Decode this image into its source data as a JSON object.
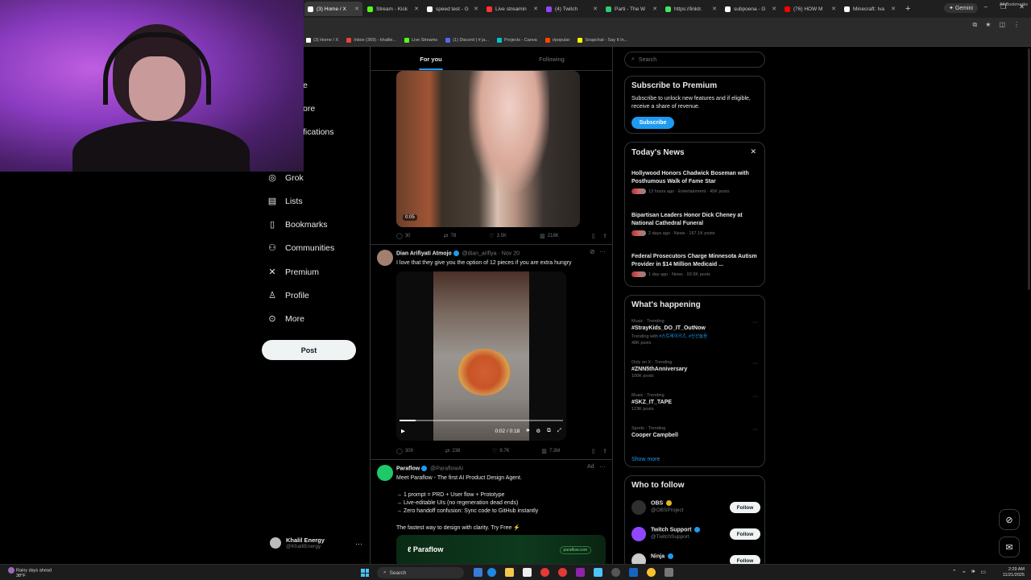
{
  "browser": {
    "tabs": [
      {
        "label": "(3) Home / X",
        "color": "#ffffff",
        "active": true
      },
      {
        "label": "Stream - Kick",
        "color": "#53fc18"
      },
      {
        "label": "speed test - G",
        "color": "#ffffff"
      },
      {
        "label": "Live streamin",
        "color": "#ff3333"
      },
      {
        "label": "(4) Twitch",
        "color": "#9146ff"
      },
      {
        "label": "Parti - The W",
        "color": "#2ecc71"
      },
      {
        "label": "https://linktr.",
        "color": "#43e660"
      },
      {
        "label": "subpoena - G",
        "color": "#ffffff"
      },
      {
        "label": "(76) HOW M",
        "color": "#ff0000"
      },
      {
        "label": "Minecraft: Iva",
        "color": "#ffffff"
      }
    ],
    "gemini_label": "Gemini",
    "bookmarks": [
      {
        "label": "(3) Home / X",
        "color": "#ffffff"
      },
      {
        "label": "Inbox (369) - khalile...",
        "color": "#ea4335"
      },
      {
        "label": "Live Streams",
        "color": "#53fc18"
      },
      {
        "label": "(1) Discord | # ja...",
        "color": "#5865f2"
      },
      {
        "label": "Projects - Canva",
        "color": "#00c4cc"
      },
      {
        "label": "r/popular",
        "color": "#ff4500"
      },
      {
        "label": "Snapchat - Say It In...",
        "color": "#fffc00"
      }
    ],
    "all_bookmarks": "All Bookmarks"
  },
  "sidebar": {
    "cut_items": [
      {
        "label": "e"
      },
      {
        "label": "ore"
      },
      {
        "label": "fications"
      }
    ],
    "items": [
      {
        "label": "Grok",
        "icon": "grok-icon",
        "glyph": "◎"
      },
      {
        "label": "Lists",
        "icon": "list-icon",
        "glyph": "▤"
      },
      {
        "label": "Bookmarks",
        "icon": "bookmark-icon",
        "glyph": "▯"
      },
      {
        "label": "Communities",
        "icon": "communities-icon",
        "glyph": "⚇"
      },
      {
        "label": "Premium",
        "icon": "x-logo-icon",
        "glyph": "✕"
      },
      {
        "label": "Profile",
        "icon": "profile-icon",
        "glyph": "♙"
      },
      {
        "label": "More",
        "icon": "more-circle-icon",
        "glyph": "⊙"
      }
    ],
    "post_label": "Post",
    "account": {
      "name": "Khalil Energy",
      "handle": "@KhalilEnergy"
    }
  },
  "feed": {
    "tabs": [
      "For you",
      "Following"
    ],
    "tweet1": {
      "video_time": "0:05",
      "replies": "30",
      "reposts": "78",
      "likes": "3.5K",
      "views": "218K"
    },
    "tweet2": {
      "name": "Dian Arifiyati Atmojo",
      "handle": "@dian_arifiya",
      "date": "· Nov 20",
      "text": "I love that they give you the option of 12 pieces if you are extra hungry",
      "video_time": "0:02 / 0:18",
      "progress": 0.1,
      "replies": "309",
      "reposts": "238",
      "likes": "9.7K",
      "views": "7.3M"
    },
    "tweet3": {
      "name": "Paraflow",
      "handle": "@ParaflowAI",
      "ad_label": "Ad",
      "lines": [
        "Meet Paraflow - The first AI Product Design Agent.",
        "",
        "→ 1 prompt = PRD + User flow + Prototype",
        "→ Live-editable UIs (no regeneration dead ends)",
        "→ Zero handoff confusion: Sync code to GitHub instantly",
        "",
        "The fastest way to design with clarity. Try Free ⚡"
      ],
      "card_brand": "Paraflow",
      "card_url": "paraflow.com"
    }
  },
  "right": {
    "search_placeholder": "Search",
    "premium": {
      "title": "Subscribe to Premium",
      "text": "Subscribe to unlock new features and if eligible, receive a share of revenue.",
      "button": "Subscribe"
    },
    "news": {
      "title": "Today's News",
      "items": [
        {
          "headline": "Hollywood Honors Chadwick Boseman with Posthumous Walk of Fame Star",
          "meta": "13 hours ago · Entertainment · 45K posts"
        },
        {
          "headline": "Bipartisan Leaders Honor Dick Cheney at National Cathedral Funeral",
          "meta": "2 days ago · News · 167.1K posts"
        },
        {
          "headline": "Federal Prosecutors Charge Minnesota Autism Provider in $14 Million Medicaid ...",
          "meta": "1 day ago · News · 93.5K posts"
        }
      ]
    },
    "happening": {
      "title": "What's happening",
      "trends": [
        {
          "category": "Music · Trending",
          "tag": "#StrayKids_DO_IT_OutNow",
          "with_prefix": "Trending with",
          "with": "#스트레이키즈, #신선놀음",
          "count": "48K posts"
        },
        {
          "category": "Only on X · Trending",
          "tag": "#ZNN5thAnniversary",
          "count": "100K posts"
        },
        {
          "category": "Music · Trending",
          "tag": "#SKZ_IT_TAPE",
          "count": "123K posts"
        },
        {
          "category": "Sports · Trending",
          "tag": "Cooper Campbell",
          "count": ""
        }
      ],
      "show_more": "Show more"
    },
    "follow": {
      "title": "Who to follow",
      "accounts": [
        {
          "name": "OBS",
          "handle": "@OBSProject",
          "button": "Follow",
          "color": "#302e31"
        },
        {
          "name": "Twitch Support",
          "handle": "@TwitchSupport",
          "button": "Follow",
          "color": "#9146ff"
        },
        {
          "name": "Ninja",
          "handle": "",
          "button": "Follow",
          "color": "#cccccc"
        }
      ]
    }
  },
  "taskbar": {
    "weather_line1": "Rainy days ahead",
    "weather_line2": "38°F",
    "search_label": "Search",
    "time": "2:29 AM",
    "date": "11/21/2025"
  }
}
